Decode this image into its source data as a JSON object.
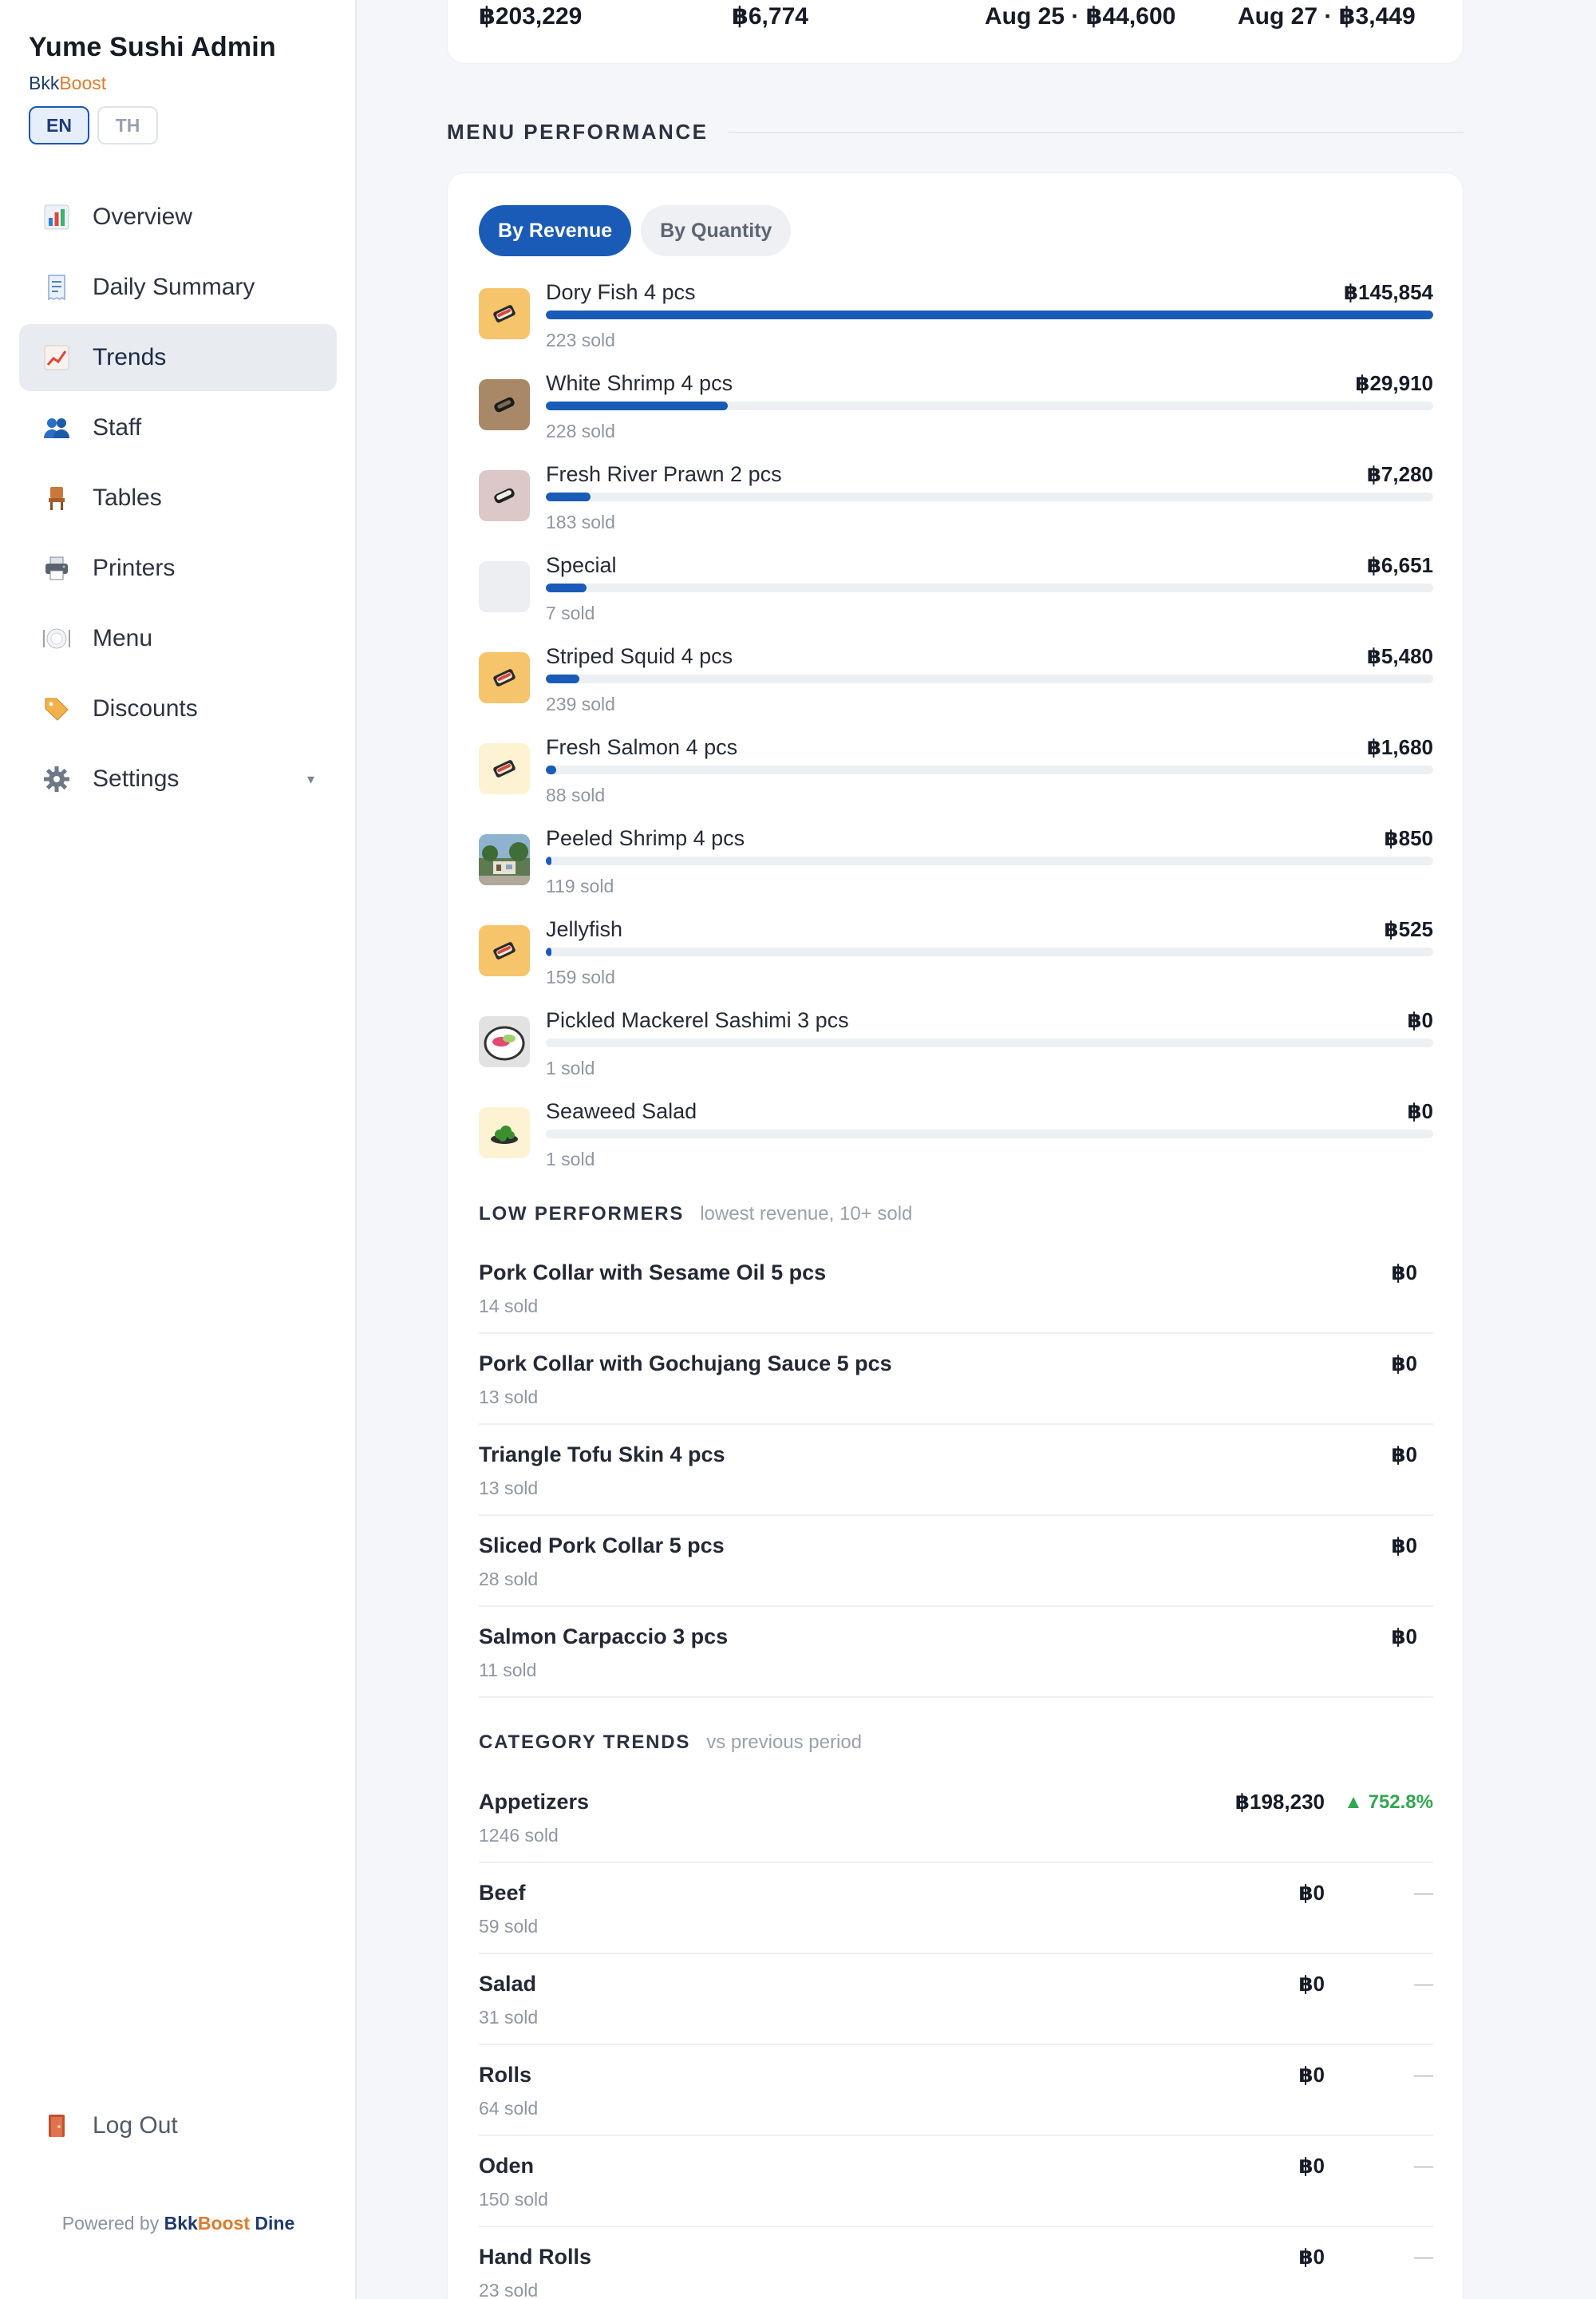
{
  "app": {
    "title": "Yume Sushi Admin",
    "brand_part1": "Bkk",
    "brand_part2": "Boost"
  },
  "lang": {
    "en": "EN",
    "th": "TH",
    "active": "EN"
  },
  "nav": [
    {
      "label": "Overview",
      "icon": "bar-chart-icon"
    },
    {
      "label": "Daily Summary",
      "icon": "receipt-icon"
    },
    {
      "label": "Trends",
      "icon": "trend-up-icon",
      "active": true
    },
    {
      "label": "Staff",
      "icon": "people-icon"
    },
    {
      "label": "Tables",
      "icon": "chair-icon"
    },
    {
      "label": "Printers",
      "icon": "printer-icon"
    },
    {
      "label": "Menu",
      "icon": "plate-icon"
    },
    {
      "label": "Discounts",
      "icon": "tag-icon"
    },
    {
      "label": "Settings",
      "icon": "gear-icon",
      "caret": "▾"
    }
  ],
  "logout": {
    "label": "Log Out",
    "icon": "door-icon"
  },
  "powered": {
    "prefix": "Powered by",
    "bkk": "Bkk",
    "boost": "Boost",
    "dine": "Dine"
  },
  "stats": [
    "฿203,229",
    "฿6,774",
    "Aug 25 · ฿44,600",
    "Aug 27 · ฿3,449"
  ],
  "menu_performance": {
    "title": "MENU PERFORMANCE",
    "tabs": {
      "revenue": "By Revenue",
      "quantity": "By Quantity",
      "active": "revenue"
    },
    "items": [
      {
        "name": "Dory Fish 4 pcs",
        "revenue": "฿145,854",
        "sold": "223 sold",
        "share": 1.0,
        "thumb": "sushi-bento-icon",
        "thumb_bg": "#f6c46a"
      },
      {
        "name": "White Shrimp 4 pcs",
        "revenue": "฿29,910",
        "sold": "228 sold",
        "share": 0.205,
        "thumb": "dark-sushi-icon",
        "thumb_bg": "#a88867"
      },
      {
        "name": "Fresh River Prawn 2 pcs",
        "revenue": "฿7,280",
        "sold": "183 sold",
        "share": 0.05,
        "thumb": "prawn-sushi-icon",
        "thumb_bg": "#dcc7c9"
      },
      {
        "name": "Special",
        "revenue": "฿6,651",
        "sold": "7 sold",
        "share": 0.046,
        "thumb": "",
        "thumb_bg": "#eceef2"
      },
      {
        "name": "Striped Squid 4 pcs",
        "revenue": "฿5,480",
        "sold": "239 sold",
        "share": 0.038,
        "thumb": "sushi-bento-icon",
        "thumb_bg": "#f6c46a"
      },
      {
        "name": "Fresh Salmon 4 pcs",
        "revenue": "฿1,680",
        "sold": "88 sold",
        "share": 0.012,
        "thumb": "sushi-bento-icon",
        "thumb_bg": "#fdf3d2"
      },
      {
        "name": "Peeled Shrimp 4 pcs",
        "revenue": "฿850",
        "sold": "119 sold",
        "share": 0.006,
        "thumb": "restaurant-photo-icon",
        "thumb_bg": "#6d8a6a"
      },
      {
        "name": "Jellyfish",
        "revenue": "฿525",
        "sold": "159 sold",
        "share": 0.004,
        "thumb": "sushi-bento-icon",
        "thumb_bg": "#f6c46a"
      },
      {
        "name": "Pickled Mackerel Sashimi 3 pcs",
        "revenue": "฿0",
        "sold": "1 sold",
        "share": 0,
        "thumb": "sashimi-plate-icon",
        "thumb_bg": "#e2e2e2"
      },
      {
        "name": "Seaweed Salad",
        "revenue": "฿0",
        "sold": "1 sold",
        "share": 0,
        "thumb": "seaweed-icon",
        "thumb_bg": "#fdf3d2"
      }
    ]
  },
  "low_performers": {
    "title": "LOW PERFORMERS",
    "note": "lowest revenue, 10+ sold",
    "rows": [
      {
        "name": "Pork Collar with Sesame Oil 5 pcs",
        "sold": "14 sold",
        "value": "฿0"
      },
      {
        "name": "Pork Collar with Gochujang Sauce 5 pcs",
        "sold": "13 sold",
        "value": "฿0"
      },
      {
        "name": "Triangle Tofu Skin 4 pcs",
        "sold": "13 sold",
        "value": "฿0"
      },
      {
        "name": "Sliced Pork Collar 5 pcs",
        "sold": "28 sold",
        "value": "฿0"
      },
      {
        "name": "Salmon Carpaccio 3 pcs",
        "sold": "11 sold",
        "value": "฿0"
      }
    ]
  },
  "category_trends": {
    "title": "CATEGORY TRENDS",
    "note": "vs previous period",
    "rows": [
      {
        "name": "Appetizers",
        "sold": "1246 sold",
        "value": "฿198,230",
        "change": "▲ 752.8%",
        "dir": "up"
      },
      {
        "name": "Beef",
        "sold": "59 sold",
        "value": "฿0",
        "change": "—",
        "dir": "none"
      },
      {
        "name": "Salad",
        "sold": "31 sold",
        "value": "฿0",
        "change": "—",
        "dir": "none"
      },
      {
        "name": "Rolls",
        "sold": "64 sold",
        "value": "฿0",
        "change": "—",
        "dir": "none"
      },
      {
        "name": "Oden",
        "sold": "150 sold",
        "value": "฿0",
        "change": "—",
        "dir": "none"
      },
      {
        "name": "Hand Rolls",
        "sold": "23 sold",
        "value": "฿0",
        "change": "—",
        "dir": "none"
      }
    ]
  }
}
